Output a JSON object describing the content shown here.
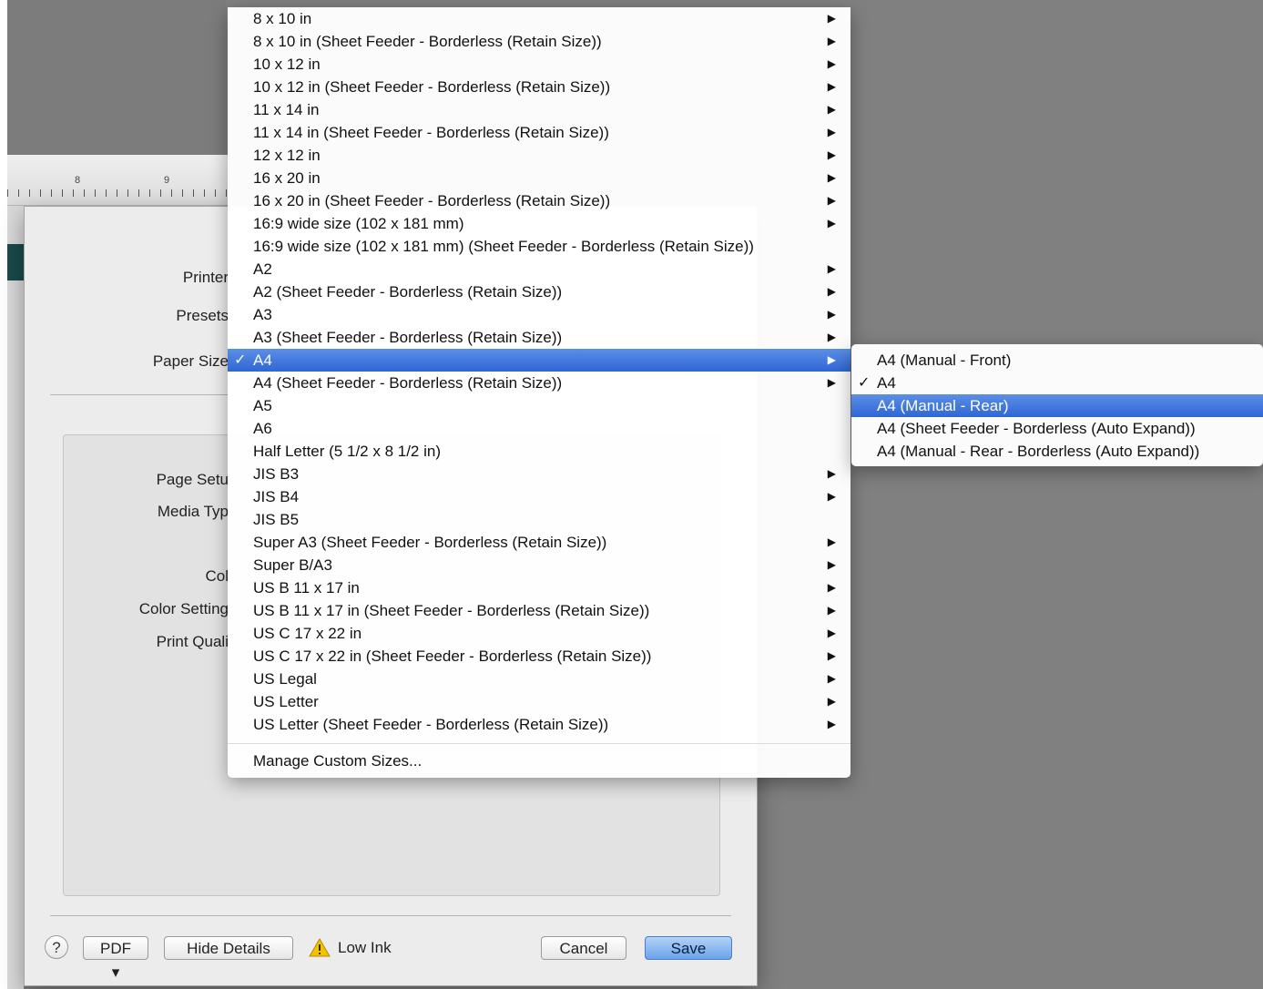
{
  "ruler": {
    "marks": [
      "8",
      "9"
    ]
  },
  "dialog": {
    "labels": {
      "printer": "Printer",
      "presets": "Presets",
      "paper_size": "Paper Size",
      "page_setup": "Page Setu",
      "media_type": "Media Typ",
      "color": "Col",
      "color_settings": "Color Setting",
      "print_quality": "Print Quali"
    },
    "footer": {
      "help": "?",
      "pdf": "PDF ▾",
      "hide_details": "Hide Details",
      "low_ink": "Low Ink",
      "cancel": "Cancel",
      "save": "Save"
    }
  },
  "paper_menu": {
    "items": [
      {
        "label": "8 x 10 in",
        "submenu": true
      },
      {
        "label": "8 x 10 in (Sheet Feeder - Borderless (Retain Size))",
        "submenu": true
      },
      {
        "label": "10 x 12 in",
        "submenu": true
      },
      {
        "label": "10 x 12 in (Sheet Feeder - Borderless (Retain Size))",
        "submenu": true
      },
      {
        "label": "11 x 14 in",
        "submenu": true
      },
      {
        "label": "11 x 14 in (Sheet Feeder - Borderless (Retain Size))",
        "submenu": true
      },
      {
        "label": "12 x 12 in",
        "submenu": true
      },
      {
        "label": "16 x 20 in",
        "submenu": true
      },
      {
        "label": "16 x 20 in (Sheet Feeder - Borderless (Retain Size))",
        "submenu": true
      },
      {
        "label": "16:9 wide size (102 x 181 mm)",
        "submenu": true
      },
      {
        "label": "16:9 wide size (102 x 181 mm) (Sheet Feeder - Borderless (Retain Size))",
        "submenu": false
      },
      {
        "label": "A2",
        "submenu": true
      },
      {
        "label": "A2 (Sheet Feeder - Borderless (Retain Size))",
        "submenu": true
      },
      {
        "label": "A3",
        "submenu": true
      },
      {
        "label": "A3 (Sheet Feeder - Borderless (Retain Size))",
        "submenu": true
      },
      {
        "label": "A4",
        "submenu": true,
        "checked": true,
        "highlighted": true
      },
      {
        "label": "A4 (Sheet Feeder - Borderless (Retain Size))",
        "submenu": true
      },
      {
        "label": "A5",
        "submenu": false
      },
      {
        "label": "A6",
        "submenu": false
      },
      {
        "label": "Half Letter (5 1/2 x 8 1/2 in)",
        "submenu": false
      },
      {
        "label": "JIS B3",
        "submenu": true
      },
      {
        "label": "JIS B4",
        "submenu": true
      },
      {
        "label": "JIS B5",
        "submenu": false
      },
      {
        "label": "Super A3 (Sheet Feeder - Borderless (Retain Size))",
        "submenu": true
      },
      {
        "label": "Super B/A3",
        "submenu": true
      },
      {
        "label": "US B 11 x 17 in",
        "submenu": true
      },
      {
        "label": "US B 11 x 17 in (Sheet Feeder - Borderless (Retain Size))",
        "submenu": true
      },
      {
        "label": "US C 17 x 22 in",
        "submenu": true
      },
      {
        "label": "US C 17 x 22 in (Sheet Feeder - Borderless (Retain Size))",
        "submenu": true
      },
      {
        "label": "US Legal",
        "submenu": true
      },
      {
        "label": "US Letter",
        "submenu": true
      },
      {
        "label": "US Letter (Sheet Feeder - Borderless (Retain Size))",
        "submenu": true
      }
    ],
    "manage_custom": "Manage Custom Sizes..."
  },
  "a4_submenu": {
    "items": [
      {
        "label": "A4 (Manual - Front)"
      },
      {
        "label": "A4",
        "checked": true
      },
      {
        "label": "A4 (Manual - Rear)",
        "highlighted": true
      },
      {
        "label": "A4 (Sheet Feeder - Borderless (Auto Expand))"
      },
      {
        "label": "A4 (Manual - Rear - Borderless (Auto Expand))"
      }
    ]
  },
  "glyphs": {
    "arrow": "▶",
    "check": "✓"
  },
  "colors": {
    "highlight": "#3a70dc",
    "warning": "#f2c200",
    "background": "#808080"
  }
}
